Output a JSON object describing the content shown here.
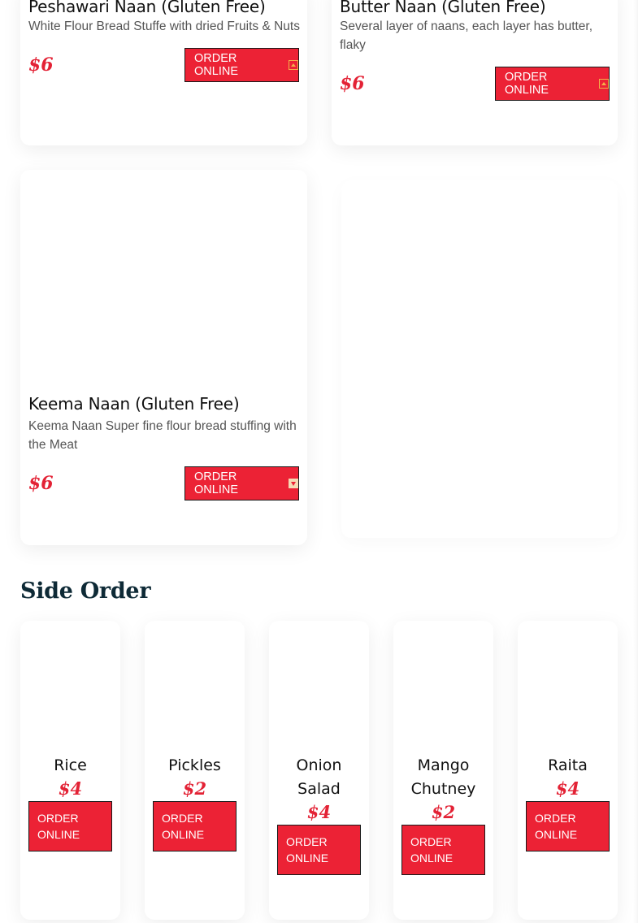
{
  "naan_items": [
    {
      "title": "Peshawari Naan (Gluten Free)",
      "description": "White Flour Bread Stuffe with dried Fruits & Nuts",
      "price": "$6",
      "button_label": "ORDER ONLINE",
      "button_icon": "arrow-up-box-icon"
    },
    {
      "title": "Butter Naan (Gluten Free)",
      "description": "Several layer of naans, each layer has butter, flaky",
      "price": "$6",
      "button_label": "ORDER ONLINE",
      "button_icon": "arrow-up-box-icon"
    },
    {
      "title": "Keema Naan (Gluten Free)",
      "description": "Keema Naan Super fine flour bread stuffing with the Meat",
      "price": "$6",
      "button_label": "ORDER ONLINE",
      "button_icon": "arrow-down-box-icon"
    }
  ],
  "side_order": {
    "heading": "Side Order",
    "items": [
      {
        "name": "Rice",
        "price": "$4",
        "button_label": "ORDER ONLINE"
      },
      {
        "name": "Pickles",
        "price": "$2",
        "button_label": "ORDER ONLINE"
      },
      {
        "name": "Onion Salad",
        "price": "$4",
        "button_label": "ORDER ONLINE"
      },
      {
        "name": "Mango Chutney",
        "price": "$2",
        "button_label": "ORDER ONLINE"
      },
      {
        "name": "Raita",
        "price": "$4",
        "button_label": "ORDER ONLINE"
      }
    ]
  },
  "colors": {
    "accent_red": "#ec2235",
    "price_red": "#e32235",
    "heading_navy": "#0e2a36",
    "icon_orange": "#f3b04a"
  }
}
